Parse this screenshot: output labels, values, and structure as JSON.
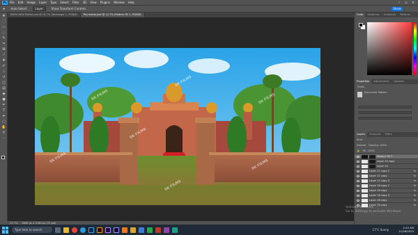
{
  "menu": {
    "logo": "Ps",
    "items": [
      "File",
      "Edit",
      "Image",
      "Layer",
      "Type",
      "Select",
      "Filter",
      "3D",
      "View",
      "Plugins",
      "Window",
      "Help"
    ],
    "share_label": "Share"
  },
  "options": {
    "auto_select": "Auto-Select",
    "layer_select": "Layer",
    "show_transform": "Show Transform Controls"
  },
  "tabs": [
    {
      "label": "BKFM NEW Malika.psd @ 16.7% (Rectangle 1, RGB/8)"
    },
    {
      "label": "Raj mahal.psd @ 12.7% (Pattern Fill 1, RGB/8)"
    }
  ],
  "watermarks": [
    "SK FILMS",
    "SK FILMS",
    "SK FILMS",
    "SK FILMS",
    "SK FILMS",
    "SK FILMS",
    "SK FILMS"
  ],
  "status": {
    "zoom": "12.7%",
    "doc": "3840 px x 2160 px (72 ppi)"
  },
  "color_panel": {
    "tabs": [
      "Color",
      "Swatches",
      "Gradients",
      "Patterns"
    ],
    "fg_color": "#000000",
    "bg_color": "#ffffff"
  },
  "properties_panel": {
    "tabs": [
      "Properties",
      "Adjustments",
      "Libraries"
    ],
    "kind": "Pixels",
    "layer_label": "Document Pattern"
  },
  "layers_panel": {
    "tabs": [
      "Layers",
      "Channels",
      "Paths"
    ],
    "kind_label": "Kind",
    "blend_mode": "Normal",
    "opacity_label": "Opacity: 100%",
    "fill_label": "Fill: 100%",
    "layers": [
      {
        "name": "Pattern Fill 1",
        "thumb": "dark",
        "fx": ""
      },
      {
        "name": "Layer 10 copy",
        "thumb": "light",
        "fx": ""
      },
      {
        "name": "Layer 10",
        "thumb": "light",
        "fx": ""
      },
      {
        "name": "Layer 11 copy 2",
        "thumb": "light",
        "fx": "fx"
      },
      {
        "name": "Layer 11 copy",
        "thumb": "light",
        "fx": "fx"
      },
      {
        "name": "Layer 11 copy 3",
        "thumb": "light",
        "fx": "fx"
      },
      {
        "name": "Layer 18 copy 2",
        "thumb": "light",
        "fx": "fx"
      },
      {
        "name": "Layer 18 copy",
        "thumb": "light",
        "fx": "fx"
      },
      {
        "name": "Layer 18 copy 3",
        "thumb": "light",
        "fx": "fx"
      },
      {
        "name": "Layer 18 copy",
        "thumb": "light",
        "fx": "fx"
      },
      {
        "name": "Layer 16 copy",
        "thumb": "light",
        "fx": "fx"
      }
    ]
  },
  "activate_windows": {
    "line1": "Activate Windows",
    "line2": "Go to Settings to activate Windows."
  },
  "taskbar": {
    "search_placeholder": "Type here to search",
    "weather": "17°C Sunny",
    "time": "2:43 AM",
    "date": "11/26/2023"
  }
}
